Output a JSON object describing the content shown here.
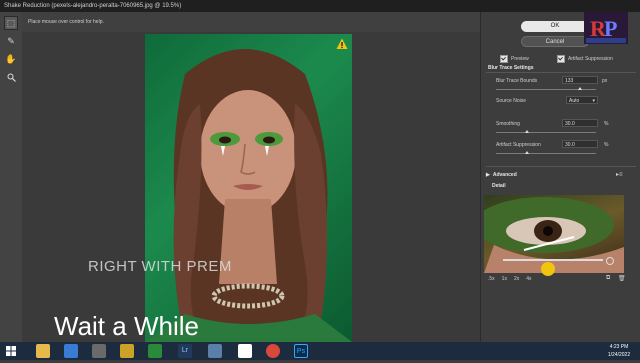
{
  "window": {
    "title": "Shake Reduction (pexels-alejandro-peralta-7060965.jpg @ 19.5%)"
  },
  "hint": {
    "text": "Place mouse over control for help."
  },
  "buttons": {
    "ok": "OK",
    "cancel": "Cancel"
  },
  "options": {
    "preview": "Preview",
    "artifact_suppression": "Artifact Suppression"
  },
  "blur_trace": {
    "heading": "Blur Trace Settings",
    "bounds_label": "Blur Trace Bounds",
    "bounds_value": "133",
    "bounds_unit": "px",
    "noise_label": "Source Noise",
    "noise_value": "Auto",
    "smoothing_label": "Smoothing",
    "smoothing_value": "30.0",
    "smoothing_unit": "%",
    "artifact_label": "Artifact Suppression",
    "artifact_value": "30.0",
    "artifact_unit": "%"
  },
  "advanced": {
    "label": "Advanced"
  },
  "detail": {
    "label": "Detail",
    "zoom_levels": [
      ".5x",
      "1x",
      "2x",
      "4x"
    ]
  },
  "watermarks": {
    "line1": "RIGHT WITH PREM",
    "line2": "Wait a While"
  },
  "logo": {
    "text": "RP",
    "tagline": "RIGHT WITH PREM"
  },
  "taskbar": {
    "time": "4:23 PM",
    "date": "1/24/2022"
  },
  "colors": {
    "accent_green": "#1c8a4d",
    "panel": "#3d3d3d",
    "taskbar": "#1d2b3f"
  }
}
